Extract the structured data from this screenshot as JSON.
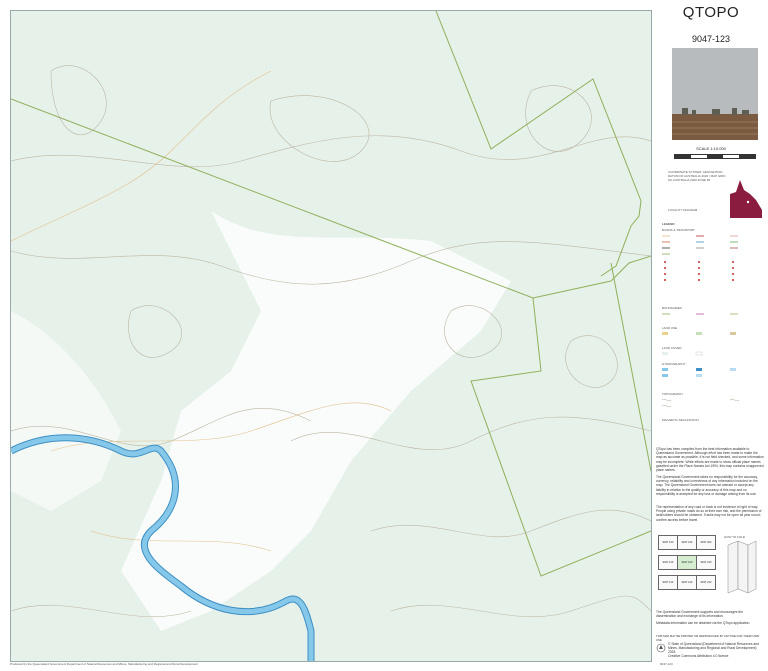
{
  "header": {
    "title": "QTOPO",
    "sheet_number": "9047-123",
    "scale": "SCALE 1:10,000"
  },
  "photo": {
    "icon": "landscape-photo",
    "colors": {
      "sky": "#b7bbbd",
      "ground": "#7a5a40"
    }
  },
  "map": {
    "colors": {
      "background": "#e6f1ea",
      "clearing": "#ffffff",
      "contour": "#bdb7a4",
      "boundary": "#8fb05a",
      "water": "#86c8ea",
      "water_edge": "#3d8fc4",
      "road": "#e2bf8c"
    }
  },
  "panel": {
    "projection_note": "COORDINATE SYSTEM: GEOCENTRIC DATUM OF AUSTRALIA 2020 / MAP GRID OF AUSTRALIA 2020 ZONE 55",
    "locality_note": "LOCALITY DIAGRAM",
    "qld_color": "#8a1c3f",
    "legend_heading": "LEGEND",
    "legend_sections": [
      "ROADS & TRANSPORT",
      "BOUNDARIES",
      "LAND USE",
      "LAND COVER",
      "HYDROGRAPHY",
      "TOPOGRAPHY",
      "MAGNETIC DECLINATION"
    ],
    "paragraphs": [
      "QTopo has been compiled from the best information available to Queensland Government. Although effort has been made to make the map as accurate as possible, it is not field checked, and some information may be incomplete. While efforts are made to show official place names gazetted under the Place Names Act 1994, this map contains unapproved place names.",
      "The Queensland Government takes no responsibility for the accuracy, currency, reliability and correctness of any information included on the map. The Queensland Government does not warrant or accept any liability in relation to the quality or accuracy of this map and no responsibility is accepted for any loss or damage arising from its use.",
      "The representation of any road or track is not evidence of right of way. People using private roads do so at their own risk, and the permission of landholders should be obtained. Tracks may not be open all year round; confirm access before travel."
    ],
    "index_sheets": [
      "9047 124",
      "9047 134",
      "9047 224",
      "9047 113",
      "9047 123",
      "9047 213",
      "9047 112",
      "9047 122",
      "9047 212"
    ],
    "fold_heading": "HOW TO FOLD",
    "footer_note_1": "The Queensland Government supports and encourages the dissemination and exchange of its information.",
    "footer_note_2": "Metadata information can be obtained via the QTopo application.",
    "footer_note_3": "THIS MAP MAY BE PRINTED OR REPRODUCED BY ANYONE FOR THEIR OWN USE",
    "copyright": "© State of Queensland (Department of Natural Resources and Mines, Manufacturing and Regional and Rural Development) 2025",
    "license": "Creative Commons Attribution 4.0 licence"
  },
  "bottom": {
    "left_text": "Produced by the Queensland Government Department of Natural Resources and Mines, Manufacturing and Regional and Rural Development",
    "right_text": "9047-123"
  }
}
